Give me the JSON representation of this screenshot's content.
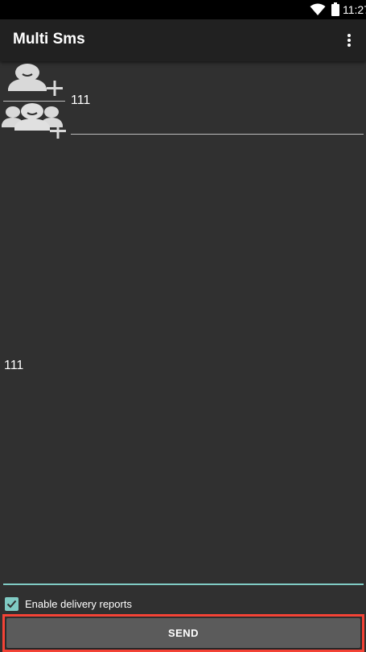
{
  "status_bar": {
    "time": "11:27",
    "icons": [
      "wifi-icon",
      "battery-icon"
    ]
  },
  "toolbar": {
    "title": "Multi Sms",
    "overflow_icon": "more-vert-icon"
  },
  "recipients": {
    "add_contact_icon": "add-contact-icon",
    "add_group_icon": "add-group-icon",
    "recipient_value": "111",
    "group_field_value": ""
  },
  "message": {
    "text": "111"
  },
  "options": {
    "delivery_reports_label": "Enable delivery reports",
    "delivery_reports_checked": true
  },
  "actions": {
    "send_label": "SEND"
  },
  "colors": {
    "background": "#303030",
    "toolbar": "#212121",
    "accent": "#80cbc4",
    "button": "#5b5b5b",
    "highlight": "#f44336"
  }
}
